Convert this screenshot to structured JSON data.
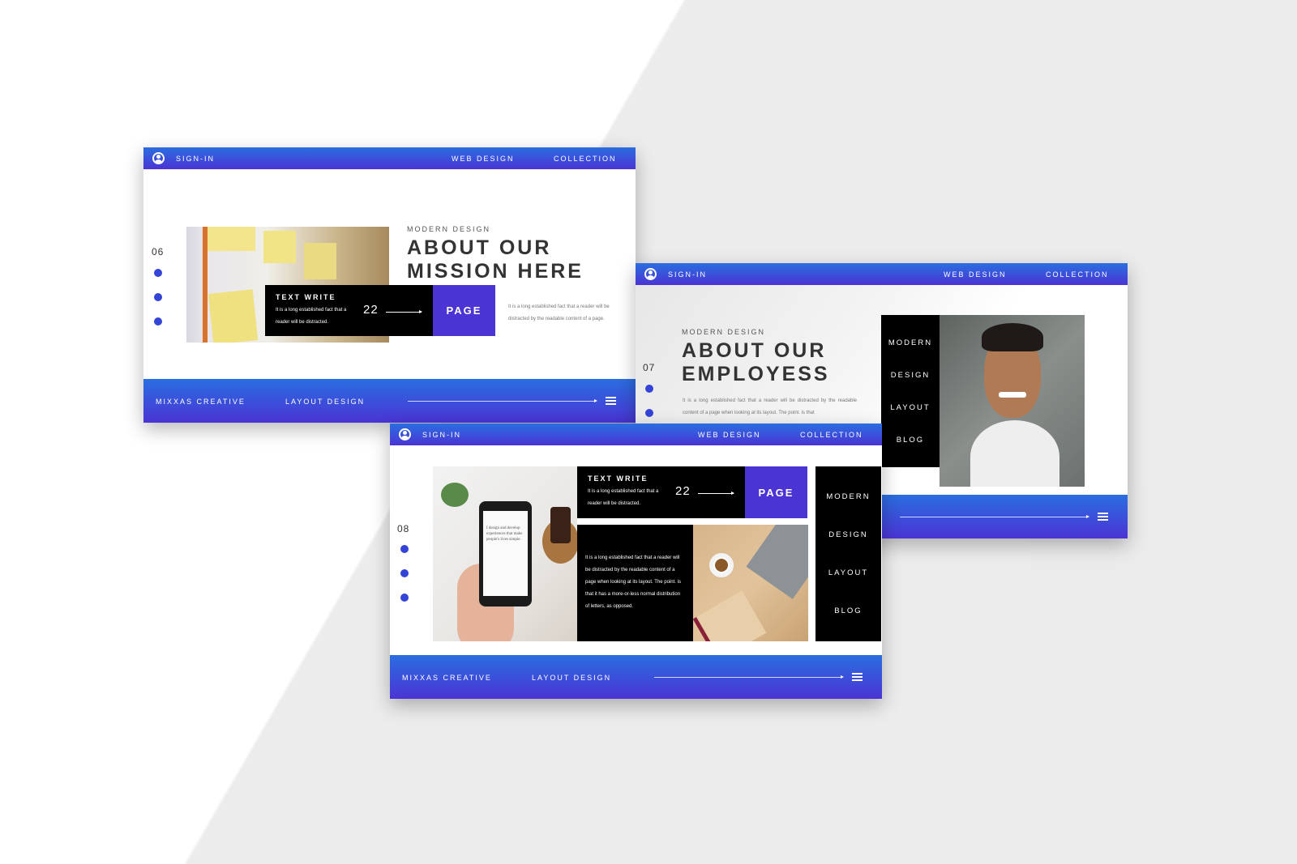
{
  "header": {
    "sign_in": "SIGN-IN",
    "web_design": "WEB DESIGN",
    "collection": "COLLECTION"
  },
  "footer": {
    "brand": "MIXXAS CREATIVE",
    "layout": "LAYOUT DESIGN"
  },
  "box": {
    "title": "TEXT WRITE",
    "text": "It is a long established fact that a reader will be distracted.",
    "number": "22",
    "page": "PAGE"
  },
  "nav": [
    "MODERN",
    "DESIGN",
    "LAYOUT",
    "BLOG"
  ],
  "slide1": {
    "number": "06",
    "kicker": "MODERN DESIGN",
    "title_line1": "ABOUT OUR",
    "title_line2": "MISSION HERE",
    "body": "It is a long established fact that a reader will be distracted by the readable content of a page."
  },
  "slide2": {
    "number": "07",
    "kicker": "MODERN DESIGN",
    "title_line1": "ABOUT OUR",
    "title_line2": "EMPLOYESS",
    "body": "It is a long established fact that a reader will be distracted by the readable content of a page when looking at its layout. The point. is that"
  },
  "slide3": {
    "number": "08",
    "body": "It is a long established fact that a reader will be distracted by the readable content of a page when looking at its layout. The point. is that it has a more-or-less normal distribution of letters, as opposed.",
    "phone_text": "I design and develop experiences that make people's lives simple."
  },
  "colors": {
    "accent": "#4a34d4",
    "header_top": "#2a6ee0",
    "dot": "#3344d6",
    "dark": "#000000"
  }
}
